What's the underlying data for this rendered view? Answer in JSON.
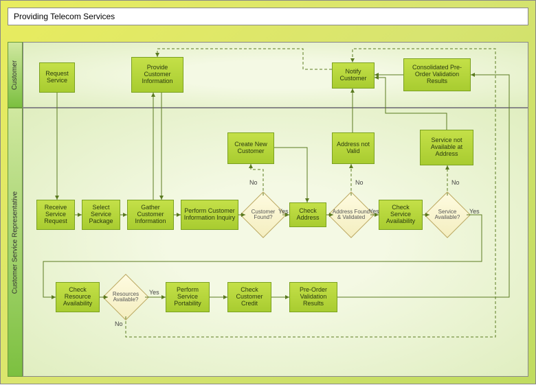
{
  "title": "Providing Telecom Services",
  "lanes": {
    "customer": "Customer",
    "csr": "Customer Service Representative"
  },
  "nodes": {
    "request_service": "Request Service",
    "provide_info": "Provide Customer Information",
    "notify_customer": "Notify Customer",
    "consolidated": "Consolidated Pre-Order Validation Results",
    "create_new": "Create New Customer",
    "addr_not_valid": "Address not Valid",
    "svc_not_avail": "Service not Available at Address",
    "receive_req": "Receive Service Request",
    "select_pkg": "Select Service Package",
    "gather_info": "Gather Customer Information",
    "perform_inq": "Perform Customer Information Inquiry",
    "cust_found": "Customer Found?",
    "check_addr": "Check Address",
    "addr_found": "Address Found & Validated",
    "check_svc": "Check Service Availability",
    "svc_avail": "Service Available?",
    "check_res": "Check Resource Availability",
    "res_avail": "Resources Available?",
    "perform_port": "Perform Service Portability",
    "check_credit": "Check Customer Credit",
    "preorder": "Pre-Order Validation Results"
  },
  "edges": {
    "yes": "Yes",
    "no": "No"
  },
  "chart_data": {
    "type": "swimlane-flowchart",
    "title": "Providing Telecom Services",
    "lanes": [
      "Customer",
      "Customer Service Representative"
    ],
    "nodes": [
      {
        "id": "request_service",
        "lane": "Customer",
        "type": "process",
        "label": "Request Service"
      },
      {
        "id": "provide_info",
        "lane": "Customer",
        "type": "process",
        "label": "Provide Customer Information"
      },
      {
        "id": "notify_customer",
        "lane": "Customer",
        "type": "process",
        "label": "Notify Customer"
      },
      {
        "id": "consolidated",
        "lane": "Customer",
        "type": "process",
        "label": "Consolidated Pre-Order Validation Results"
      },
      {
        "id": "receive_req",
        "lane": "Customer Service Representative",
        "type": "process",
        "label": "Receive Service Request"
      },
      {
        "id": "select_pkg",
        "lane": "Customer Service Representative",
        "type": "process",
        "label": "Select Service Package"
      },
      {
        "id": "gather_info",
        "lane": "Customer Service Representative",
        "type": "process",
        "label": "Gather Customer Information"
      },
      {
        "id": "perform_inq",
        "lane": "Customer Service Representative",
        "type": "process",
        "label": "Perform Customer Information Inquiry"
      },
      {
        "id": "cust_found",
        "lane": "Customer Service Representative",
        "type": "decision",
        "label": "Customer Found?"
      },
      {
        "id": "create_new",
        "lane": "Customer Service Representative",
        "type": "process",
        "label": "Create New Customer"
      },
      {
        "id": "check_addr",
        "lane": "Customer Service Representative",
        "type": "process",
        "label": "Check Address"
      },
      {
        "id": "addr_found",
        "lane": "Customer Service Representative",
        "type": "decision",
        "label": "Address Found & Validated"
      },
      {
        "id": "addr_not_valid",
        "lane": "Customer Service Representative",
        "type": "process",
        "label": "Address not Valid"
      },
      {
        "id": "check_svc",
        "lane": "Customer Service Representative",
        "type": "process",
        "label": "Check Service Availability"
      },
      {
        "id": "svc_avail",
        "lane": "Customer Service Representative",
        "type": "decision",
        "label": "Service Available?"
      },
      {
        "id": "svc_not_avail",
        "lane": "Customer Service Representative",
        "type": "process",
        "label": "Service not Available at Address"
      },
      {
        "id": "check_res",
        "lane": "Customer Service Representative",
        "type": "process",
        "label": "Check Resource Availability"
      },
      {
        "id": "res_avail",
        "lane": "Customer Service Representative",
        "type": "decision",
        "label": "Resources Available?"
      },
      {
        "id": "perform_port",
        "lane": "Customer Service Representative",
        "type": "process",
        "label": "Perform Service Portability"
      },
      {
        "id": "check_credit",
        "lane": "Customer Service Representative",
        "type": "process",
        "label": "Check Customer Credit"
      },
      {
        "id": "preorder",
        "lane": "Customer Service Representative",
        "type": "process",
        "label": "Pre-Order Validation Results"
      }
    ],
    "edges": [
      {
        "from": "request_service",
        "to": "receive_req"
      },
      {
        "from": "receive_req",
        "to": "select_pkg"
      },
      {
        "from": "select_pkg",
        "to": "gather_info"
      },
      {
        "from": "gather_info",
        "to": "provide_info"
      },
      {
        "from": "provide_info",
        "to": "gather_info"
      },
      {
        "from": "gather_info",
        "to": "perform_inq"
      },
      {
        "from": "perform_inq",
        "to": "cust_found"
      },
      {
        "from": "cust_found",
        "to": "check_addr",
        "label": "Yes"
      },
      {
        "from": "cust_found",
        "to": "create_new",
        "label": "No",
        "style": "dashed"
      },
      {
        "from": "create_new",
        "to": "check_addr"
      },
      {
        "from": "check_addr",
        "to": "addr_found"
      },
      {
        "from": "addr_found",
        "to": "check_svc",
        "label": "Yes"
      },
      {
        "from": "addr_found",
        "to": "addr_not_valid",
        "label": "No",
        "style": "dashed"
      },
      {
        "from": "addr_not_valid",
        "to": "notify_customer"
      },
      {
        "from": "check_svc",
        "to": "svc_avail"
      },
      {
        "from": "svc_avail",
        "to": "check_res",
        "label": "Yes"
      },
      {
        "from": "svc_avail",
        "to": "svc_not_avail",
        "label": "No",
        "style": "dashed"
      },
      {
        "from": "svc_not_avail",
        "to": "notify_customer"
      },
      {
        "from": "check_res",
        "to": "res_avail"
      },
      {
        "from": "res_avail",
        "to": "perform_port",
        "label": "Yes"
      },
      {
        "from": "res_avail",
        "to": "notify_customer",
        "label": "No",
        "style": "dashed"
      },
      {
        "from": "perform_port",
        "to": "check_credit"
      },
      {
        "from": "check_credit",
        "to": "preorder"
      },
      {
        "from": "preorder",
        "to": "consolidated"
      },
      {
        "from": "consolidated",
        "to": "notify_customer"
      },
      {
        "from": "notify_customer",
        "to": "provide_info",
        "style": "dashed"
      }
    ]
  }
}
